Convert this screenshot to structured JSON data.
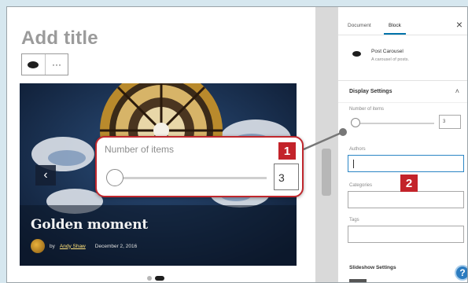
{
  "canvas": {
    "title_placeholder": "Add title",
    "toolbar": {
      "block_icon": "blob-icon",
      "more_label": "···"
    },
    "carousel": {
      "prev_arrow": "‹",
      "post_title": "Golden moment",
      "author_prefix": "by",
      "author": "Andy Shaw",
      "date": "December 2, 2016",
      "active_dot": 2,
      "dot_count": 2
    }
  },
  "sidebar": {
    "tabs": [
      {
        "label": "Document"
      },
      {
        "label": "Block"
      }
    ],
    "active_tab": "Block",
    "close_label": "×",
    "block_card": {
      "icon": "blob-icon",
      "title": "Post Carousel",
      "description": "A carousel of posts."
    },
    "display_settings": {
      "title": "Display Settings",
      "caret": "˄",
      "number_of_items_label": "Number of items",
      "number_of_items_value": "3",
      "authors_label": "Authors",
      "categories_label": "Categories",
      "tags_label": "Tags"
    },
    "other_settings_title": "Slideshow Settings",
    "help_label": "?"
  },
  "callout": {
    "label": "Number of items",
    "value": "3"
  },
  "annotations": [
    {
      "label": "1"
    },
    {
      "label": "2"
    }
  ],
  "colors": {
    "badge": "#c3232a",
    "focus_border": "#2b86c5",
    "tab_underline": "#0073aa"
  }
}
